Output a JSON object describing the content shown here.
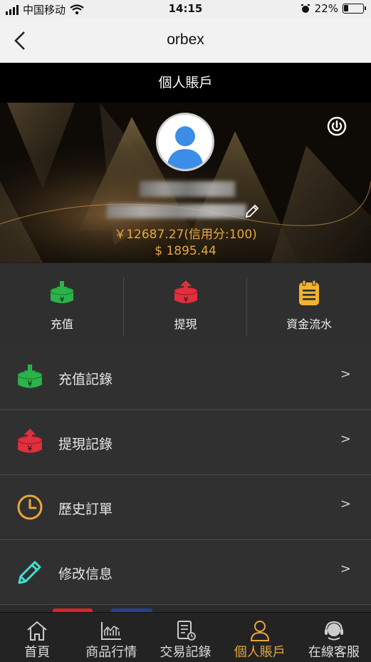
{
  "status_bar": {
    "carrier": "中国移动",
    "time": "14:15",
    "battery": "22%",
    "battery_level": 0.22
  },
  "nav": {
    "title": "orbex"
  },
  "header": {
    "title": "個人賬戶"
  },
  "profile": {
    "balance_line": "￥12687.27(信用分:100)",
    "usd_line": "$ 1895.44"
  },
  "actions": [
    {
      "label": "充值",
      "icon": "deposit-icon",
      "color": "#2bb34a"
    },
    {
      "label": "提現",
      "icon": "withdraw-icon",
      "color": "#e0303d"
    },
    {
      "label": "資金流水",
      "icon": "clipboard-icon",
      "color": "#f2b230"
    }
  ],
  "menu": [
    {
      "label": "充值記錄",
      "icon": "deposit-icon",
      "chevron": ">"
    },
    {
      "label": "提現記錄",
      "icon": "withdraw-icon",
      "chevron": ">"
    },
    {
      "label": "歷史訂單",
      "icon": "clock-icon",
      "chevron": ">"
    },
    {
      "label": "修改信息",
      "icon": "pencil-icon",
      "chevron": ">"
    }
  ],
  "tabs": [
    {
      "label": "首頁",
      "icon": "home-icon",
      "active": false
    },
    {
      "label": "商品行情",
      "icon": "chart-icon",
      "active": false
    },
    {
      "label": "交易記錄",
      "icon": "receipt-icon",
      "active": false
    },
    {
      "label": "個人賬戶",
      "icon": "user-icon",
      "active": true
    },
    {
      "label": "在線客服",
      "icon": "headset-icon",
      "active": false
    }
  ],
  "colors": {
    "accent": "#e8a73a",
    "green": "#2bb34a",
    "red": "#e0303d",
    "cyan": "#3fe0d0"
  }
}
